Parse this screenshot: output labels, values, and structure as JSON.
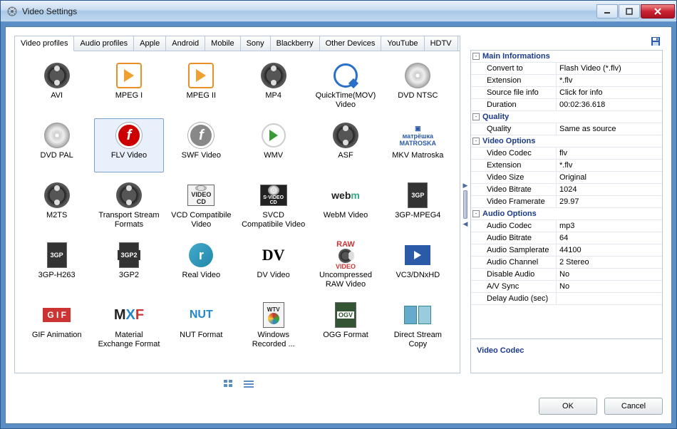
{
  "window": {
    "title": "Video Settings"
  },
  "tabs": [
    {
      "label": "Video profiles",
      "active": true
    },
    {
      "label": "Audio profiles"
    },
    {
      "label": "Apple"
    },
    {
      "label": "Android"
    },
    {
      "label": "Mobile"
    },
    {
      "label": "Sony"
    },
    {
      "label": "Blackberry"
    },
    {
      "label": "Other Devices"
    },
    {
      "label": "YouTube"
    },
    {
      "label": "HDTV"
    }
  ],
  "formats": [
    {
      "label": "AVI",
      "icon": "reel"
    },
    {
      "label": "MPEG I",
      "icon": "play"
    },
    {
      "label": "MPEG II",
      "icon": "play"
    },
    {
      "label": "MP4",
      "icon": "reel"
    },
    {
      "label": "QuickTime(MOV) Video",
      "icon": "q"
    },
    {
      "label": "DVD NTSC",
      "icon": "disc"
    },
    {
      "label": "DVD PAL",
      "icon": "disc"
    },
    {
      "label": "FLV Video",
      "icon": "flash",
      "selected": true
    },
    {
      "label": "SWF Video",
      "icon": "flashgrey"
    },
    {
      "label": "WMV",
      "icon": "wmv"
    },
    {
      "label": "ASF",
      "icon": "reel"
    },
    {
      "label": "MKV Matroska",
      "icon": "mkv"
    },
    {
      "label": "M2TS",
      "icon": "reel"
    },
    {
      "label": "Transport Stream Formats",
      "icon": "reel"
    },
    {
      "label": "VCD Compatibile Video",
      "icon": "vcd"
    },
    {
      "label": "SVCD Compatibile Video",
      "icon": "svcd"
    },
    {
      "label": "WebM Video",
      "icon": "webm"
    },
    {
      "label": "3GP-MPEG4",
      "icon": "3gp"
    },
    {
      "label": "3GP-H263",
      "icon": "3gp"
    },
    {
      "label": "3GP2",
      "icon": "3gp2"
    },
    {
      "label": "Real Video",
      "icon": "real"
    },
    {
      "label": "DV Video",
      "icon": "dv"
    },
    {
      "label": "Uncompressed RAW Video",
      "icon": "raw"
    },
    {
      "label": "VC3/DNxHD",
      "icon": "vc3"
    },
    {
      "label": "GIF Animation",
      "icon": "gif"
    },
    {
      "label": "Material Exchange Format",
      "icon": "mxf"
    },
    {
      "label": "NUT Format",
      "icon": "nut"
    },
    {
      "label": "Windows Recorded ...",
      "icon": "wtv"
    },
    {
      "label": "OGG Format",
      "icon": "ogv"
    },
    {
      "label": "Direct Stream Copy",
      "icon": "dsc"
    }
  ],
  "props": {
    "sections": [
      {
        "title": "Main Informations",
        "rows": [
          {
            "key": "Convert to",
            "val": "Flash Video (*.flv)"
          },
          {
            "key": "Extension",
            "val": "*.flv"
          },
          {
            "key": "Source file info",
            "val": "Click for info"
          },
          {
            "key": "Duration",
            "val": "00:02:36.618"
          }
        ]
      },
      {
        "title": "Quality",
        "rows": [
          {
            "key": "Quality",
            "val": "Same as source"
          }
        ]
      },
      {
        "title": "Video Options",
        "rows": [
          {
            "key": "Video Codec",
            "val": "flv"
          },
          {
            "key": "Extension",
            "val": "*.flv"
          },
          {
            "key": "Video Size",
            "val": "Original"
          },
          {
            "key": "Video Bitrate",
            "val": "1024"
          },
          {
            "key": "Video Framerate",
            "val": "29.97"
          }
        ]
      },
      {
        "title": "Audio Options",
        "rows": [
          {
            "key": "Audio Codec",
            "val": "mp3"
          },
          {
            "key": "Audio Bitrate",
            "val": "64"
          },
          {
            "key": "Audio Samplerate",
            "val": "44100"
          },
          {
            "key": "Audio Channel",
            "val": "2 Stereo"
          },
          {
            "key": "Disable Audio",
            "val": "No"
          },
          {
            "key": "A/V Sync",
            "val": "No"
          },
          {
            "key": "Delay Audio (sec)",
            "val": ""
          }
        ]
      }
    ],
    "description": "Video Codec"
  },
  "buttons": {
    "ok": "OK",
    "cancel": "Cancel"
  }
}
